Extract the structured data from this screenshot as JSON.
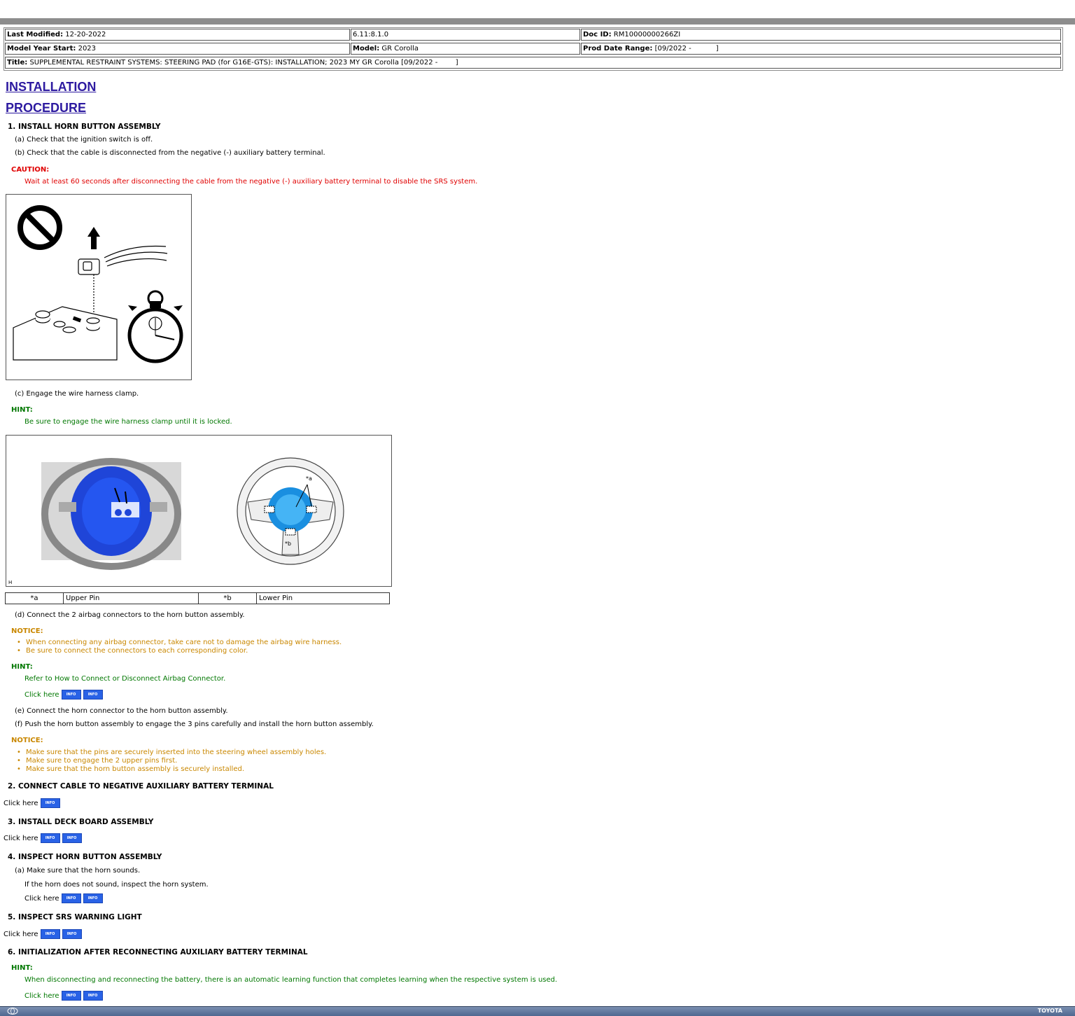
{
  "header": {
    "last_modified_label": "Last Modified:",
    "last_modified": "12-20-2022",
    "version": "6.11:8.1.0",
    "doc_id_label": "Doc ID:",
    "doc_id": "RM10000000266ZI",
    "model_year_label": "Model Year Start:",
    "model_year": "2023",
    "model_label": "Model:",
    "model": "GR Corolla",
    "prod_date_label": "Prod Date Range:",
    "prod_date": "[09/2022 -           ]",
    "title_label": "Title:",
    "title": "SUPPLEMENTAL RESTRAINT SYSTEMS: STEERING PAD (for G16E-GTS): INSTALLATION; 2023 MY GR Corolla [09/2022 -        ]"
  },
  "headings": {
    "installation": "INSTALLATION",
    "procedure": "PROCEDURE"
  },
  "step1": {
    "title": "1. INSTALL HORN BUTTON ASSEMBLY",
    "a": "(a) Check that the ignition switch is off.",
    "b": "(b) Check that the cable is disconnected from the negative (-) auxiliary battery terminal.",
    "caution_label": "CAUTION:",
    "caution_text": "Wait at least 60 seconds after disconnecting the cable from the negative (-) auxiliary battery terminal to disable the SRS system.",
    "c": "(c) Engage the wire harness clamp.",
    "hint_label": "HINT:",
    "hint_c": "Be sure to engage the wire harness clamp until it is locked.",
    "fig2_corner": "H",
    "fig2_label_a": "*a",
    "fig2_label_b": "*b",
    "legend": {
      "a_key": "*a",
      "a_val": "Upper Pin",
      "b_key": "*b",
      "b_val": "Lower Pin"
    },
    "d": "(d) Connect the 2 airbag connectors to the horn button assembly.",
    "notice_label": "NOTICE:",
    "notice_d": [
      "When connecting any airbag connector, take care not to damage the airbag wire harness.",
      "Be sure to connect the connectors to each corresponding color."
    ],
    "hint_d": "Refer to How to Connect or Disconnect Airbag Connector.",
    "e": "(e) Connect the horn connector to the horn button assembly.",
    "f": "(f) Push the horn button assembly to engage the 3 pins carefully and install the horn button assembly.",
    "notice_f": [
      "Make sure that the pins are securely inserted into the steering wheel assembly holes.",
      "Make sure to engage the 2 upper pins first.",
      "Make sure that the horn button assembly is securely installed."
    ]
  },
  "step2": {
    "title": "2. CONNECT CABLE TO NEGATIVE AUXILIARY BATTERY TERMINAL"
  },
  "step3": {
    "title": "3. INSTALL DECK BOARD ASSEMBLY"
  },
  "step4": {
    "title": "4. INSPECT HORN BUTTON ASSEMBLY",
    "a": "(a) Make sure that the horn sounds.",
    "note": "If the horn does not sound, inspect the horn system."
  },
  "step5": {
    "title": "5. INSPECT SRS WARNING LIGHT"
  },
  "step6": {
    "title": "6. INITIALIZATION AFTER RECONNECTING AUXILIARY BATTERY TERMINAL",
    "hint_label": "HINT:",
    "hint_text": "When disconnecting and reconnecting the battery, there is an automatic learning function that completes learning when the respective system is used."
  },
  "click_here": "Click here",
  "info_label": "INFO",
  "footer": {
    "brand": "TOYOTA"
  },
  "colors": {
    "caution": "#e00000",
    "hint": "#007700",
    "notice": "#c98700",
    "heading_link": "#2d1aa0",
    "info_button": "#2962e6"
  }
}
